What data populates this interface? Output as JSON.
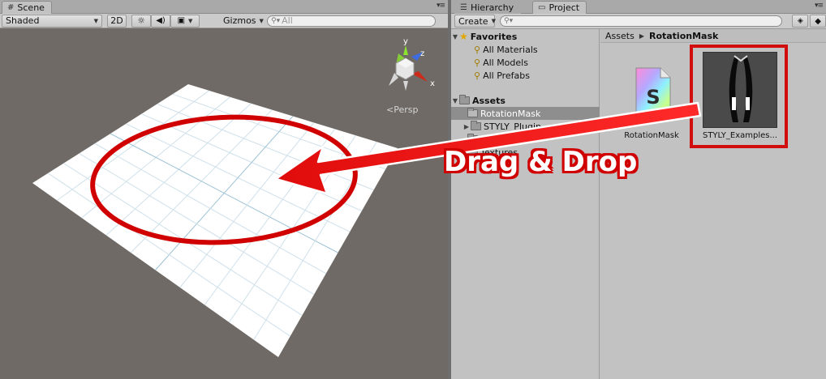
{
  "scene_panel": {
    "tab_label": "Scene",
    "shading_mode": "Shaded",
    "mode_2d": "2D",
    "gizmos_label": "Gizmos",
    "search_placeholder": "All",
    "projection_label": "Persp",
    "axes": {
      "x": "x",
      "y": "y",
      "z": "z"
    }
  },
  "project_panel": {
    "tabs": [
      {
        "label": "Hierarchy",
        "active": false
      },
      {
        "label": "Project",
        "active": true
      }
    ],
    "create_label": "Create",
    "favorites": {
      "label": "Favorites",
      "items": [
        "All Materials",
        "All Models",
        "All Prefabs"
      ]
    },
    "assets": {
      "label": "Assets",
      "folders": [
        {
          "label": "RotationMask",
          "selected": true,
          "expandable": false
        },
        {
          "label": "STYLY_Plugin",
          "selected": false,
          "expandable": true
        },
        {
          "label": "styly_temp",
          "selected": false,
          "expandable": false
        },
        {
          "label": "Textures",
          "selected": false,
          "expandable": false
        }
      ]
    },
    "breadcrumb": [
      "Assets",
      "RotationMask"
    ],
    "grid_assets": [
      {
        "label": "RotationMask",
        "icon": "shader-icon",
        "icon_letter": "S"
      },
      {
        "label": "STYLY_Examples...",
        "icon": "prefab-preview",
        "highlighted": true
      }
    ]
  },
  "annotation": {
    "text": "Drag & Drop",
    "color": "#d00000"
  }
}
